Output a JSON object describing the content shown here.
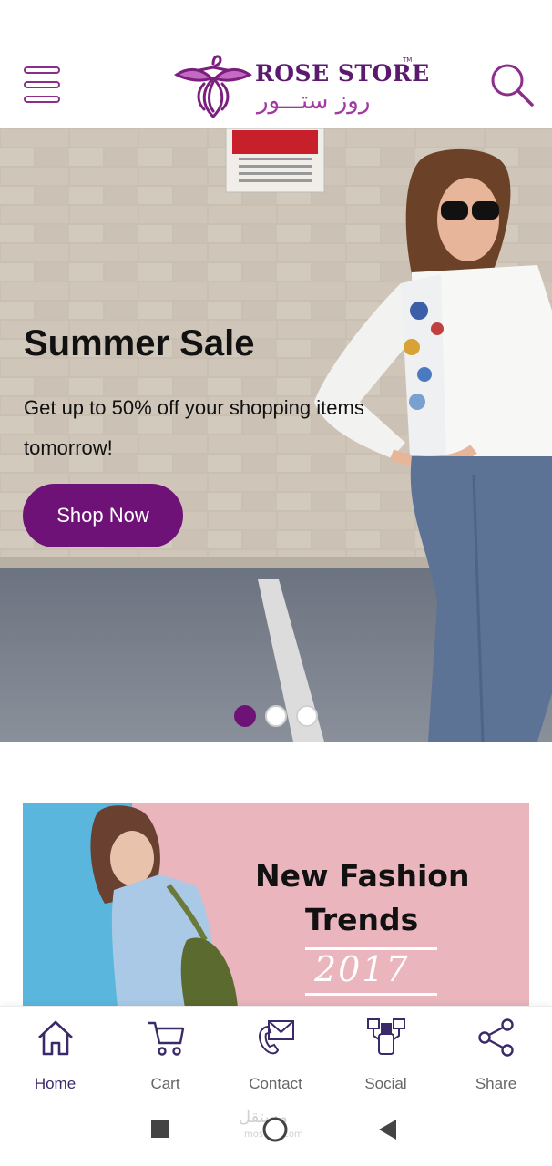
{
  "header": {
    "brand_en": "ROSE STORE",
    "brand_tm": "TM",
    "brand_ar": "روز ستـــور",
    "menu_icon": "hamburger-icon",
    "search_icon": "search-icon"
  },
  "hero": {
    "title": "Summer Sale",
    "text": "Get up to 50% off your shopping items tomorrow!",
    "button_label": "Shop Now",
    "slides_total": 3,
    "active_slide": 1
  },
  "banner": {
    "title_line1": "New Fashion",
    "title_line2": "Trends",
    "year": "2017"
  },
  "bottom_nav": {
    "items": [
      {
        "label": "Home",
        "icon": "home-icon",
        "active": true
      },
      {
        "label": "Cart",
        "icon": "cart-icon",
        "active": false
      },
      {
        "label": "Contact",
        "icon": "mail-icon",
        "active": false
      },
      {
        "label": "Social",
        "icon": "social-icon",
        "active": false
      },
      {
        "label": "Share",
        "icon": "share-icon",
        "active": false
      }
    ]
  },
  "system_bar": {
    "watermark": "مستقل",
    "watermark_sub": "mostaql.com"
  },
  "colors": {
    "brand_purple": "#6f1278",
    "logo_purple": "#5b1a6e",
    "icon_purple": "#8b2e8a",
    "banner_pink": "#eab5bd",
    "banner_blue": "#5ab6dc"
  }
}
